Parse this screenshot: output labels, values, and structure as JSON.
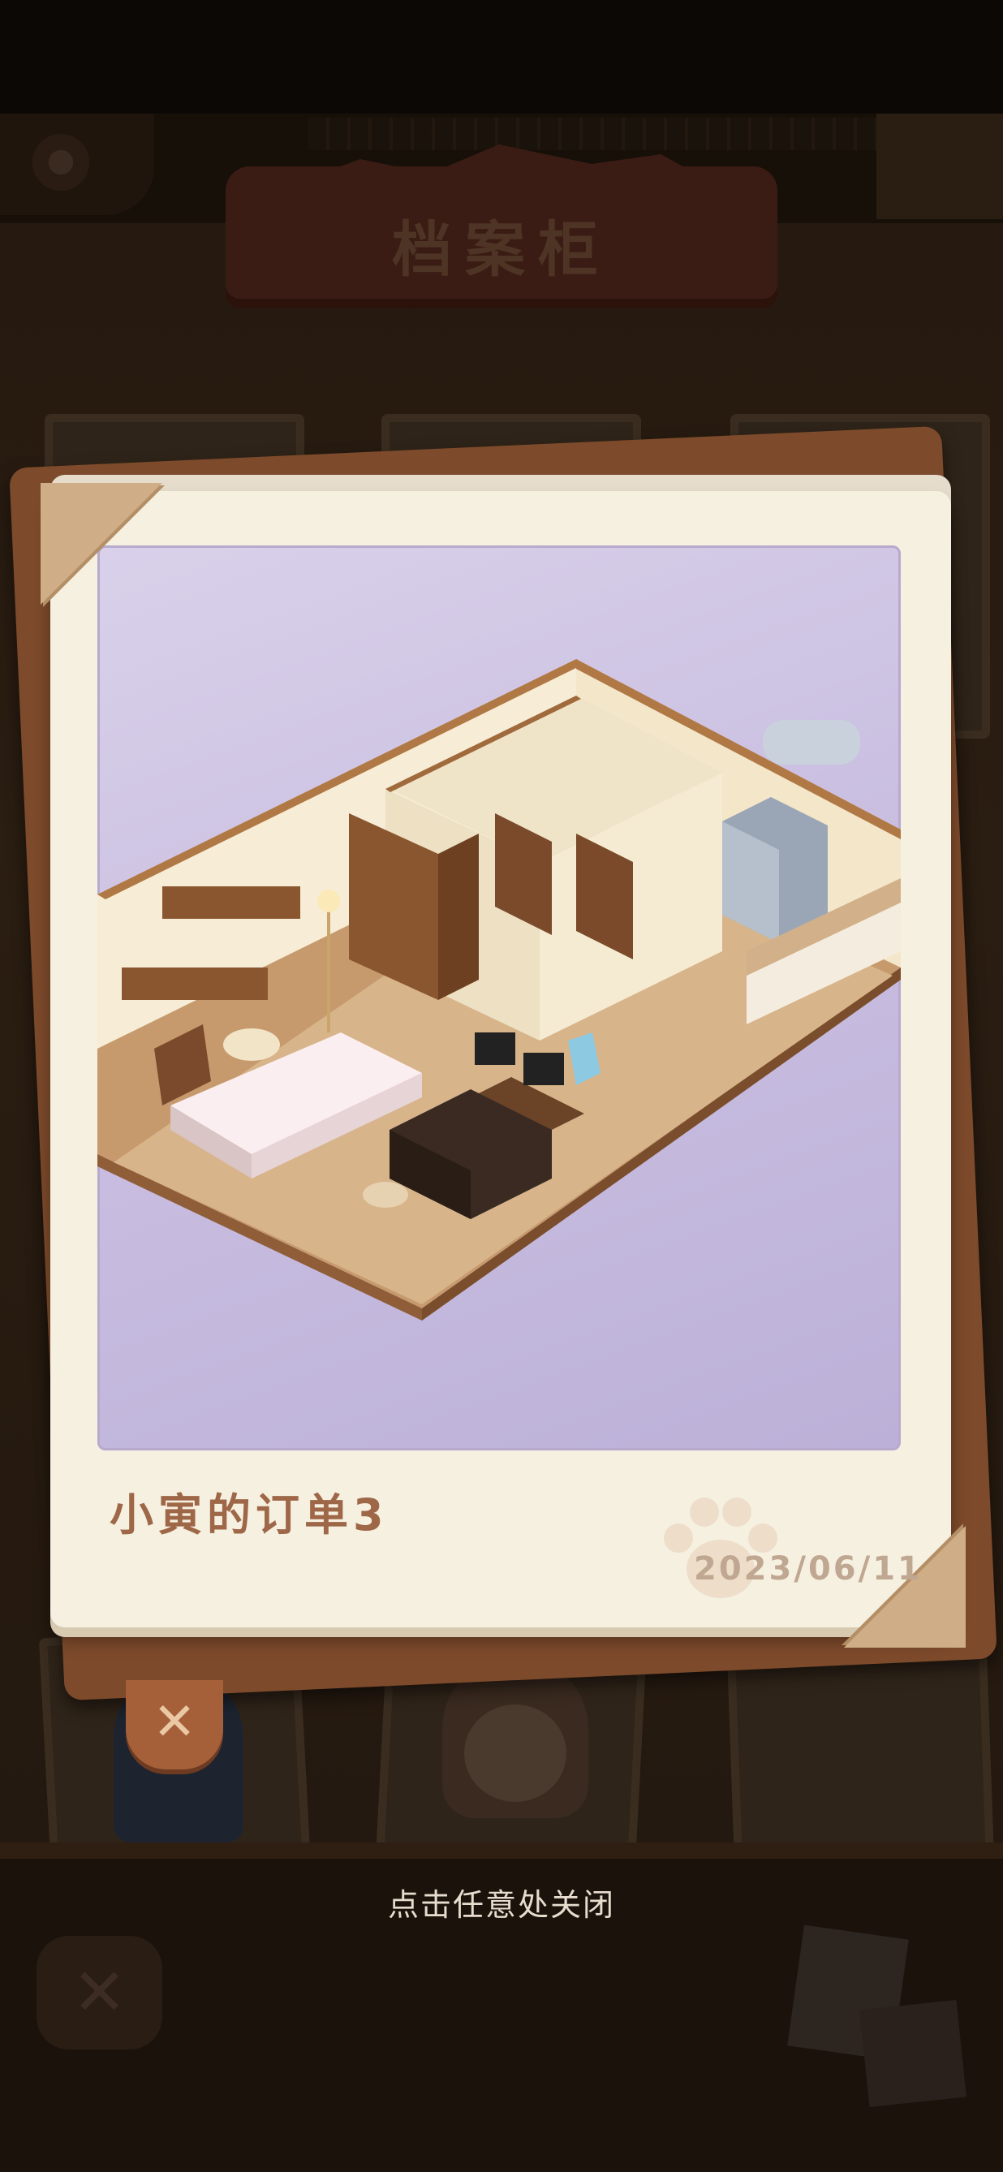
{
  "background": {
    "title": "档案柜"
  },
  "photo": {
    "caption": "小寅的订单3",
    "date": "2023/06/11"
  },
  "dismiss_hint": "点击任意处关闭",
  "icons": {
    "close_badge": "close-icon",
    "bottom_close": "close-icon",
    "paw_watermark": "paw-icon"
  },
  "colors": {
    "frame": "#f6f0e1",
    "photo_bg": "#cabfe1",
    "caption": "#9e6848",
    "date": "#c0a792"
  }
}
